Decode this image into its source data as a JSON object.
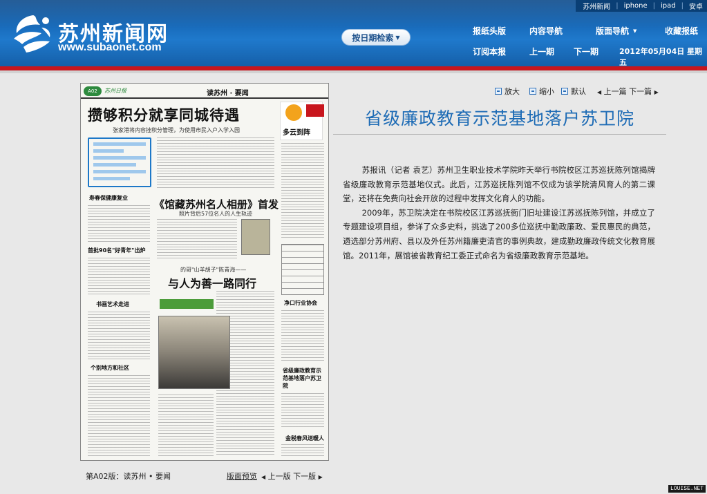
{
  "header": {
    "toplinks": [
      "苏州新闻",
      "iphone",
      "ipad",
      "安卓"
    ],
    "site_name": "苏州新闻网",
    "site_url": "www.subaonet.com",
    "date_search": "按日期检索",
    "nav_row1": [
      "报纸头版",
      "内容导航",
      "版面导航",
      "收藏报纸"
    ],
    "nav_row2": [
      "订阅本报",
      "上一期",
      "下一期"
    ],
    "issue_date": "2012年05月04日  星期五"
  },
  "paper": {
    "badge": "A02",
    "section": "读苏州 · 要闻",
    "headline": "攒够积分就享同城待遇",
    "subheadline": "张家港将内容挂积分管理，为使用市民入户入学入园",
    "headline2": "《馆藏苏州名人相册》首发",
    "headline2_sub": "照片背后57位名人的人生轨迹",
    "headline3_pre": "的哥\"山羊胡子\"陈青海——",
    "headline3": "与人为善一路同行",
    "weather": "多云到阵",
    "side_heads": [
      "寿春保健康复业",
      "首批90名\"好青年\"出炉",
      "书画艺术走进",
      "个别地方和社区",
      "净口行业协会",
      "省级廉政教育示范基地落户苏卫院",
      "金税春风送暖人"
    ]
  },
  "tools": {
    "zoom_in": "放大",
    "zoom_out": "缩小",
    "default": "默认",
    "prev_article": "上一篇",
    "next_article": "下一篇"
  },
  "article": {
    "title": "省级廉政教育示范基地落户苏卫院",
    "paragraphs": [
      "苏报讯（记者  袁艺）苏州卫生职业技术学院昨天举行书院校区江苏巡抚陈列馆揭牌省级廉政教育示范基地仪式。此后，江苏巡抚陈列馆不仅成为该学院清风育人的第二课堂，还将在免费向社会开放的过程中发挥文化育人的功能。",
      "2009年，苏卫院决定在书院校区江苏巡抚衙门旧址建设江苏巡抚陈列馆，并成立了专题建设项目组，参详了众多史料，挑选了200多位巡抚中勤政廉政、爱民惠民的典范，遴选部分苏州府、县以及外任苏州籍廉吏清官的事例典故，建成勤政廉政传统文化教育展馆。2011年，展馆被省教育纪工委正式命名为省级廉政教育示范基地。"
    ]
  },
  "footer": {
    "page_label": "第A02版：读苏州 • 要闻",
    "preview": "版面预览",
    "prev_page": "上一版",
    "next_page": "下一版",
    "watermark": "LOUISE.NET"
  }
}
